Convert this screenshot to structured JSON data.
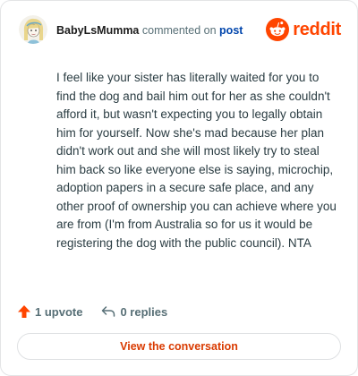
{
  "byline": {
    "username": "BabyLsMumma",
    "commented_on": "commented on",
    "post_link": "post"
  },
  "brand": {
    "wordmark": "reddit",
    "icon": "reddit-snoo-icon",
    "color": "#ff4500"
  },
  "comment": {
    "text": "I feel like your sister has literally waited for you to find the dog and bail him out for her as she couldn't afford it, but wasn't expecting you to legally obtain him for yourself. Now she's mad because her plan didn't work out and she will most likely try to steal him back so like everyone else is saying, microchip, adoption papers in a secure safe place, and any other proof of ownership you can achieve where you are from (I'm from Australia so for us it would be registering the dog with the public council). NTA"
  },
  "actions": {
    "upvotes": "1 upvote",
    "upvote_icon": "upvote-arrow-icon",
    "upvote_color": "#ff4500",
    "replies": "0 replies",
    "reply_icon": "reply-arrow-icon"
  },
  "cta": {
    "label": "View the conversation",
    "color": "#d93a00"
  }
}
